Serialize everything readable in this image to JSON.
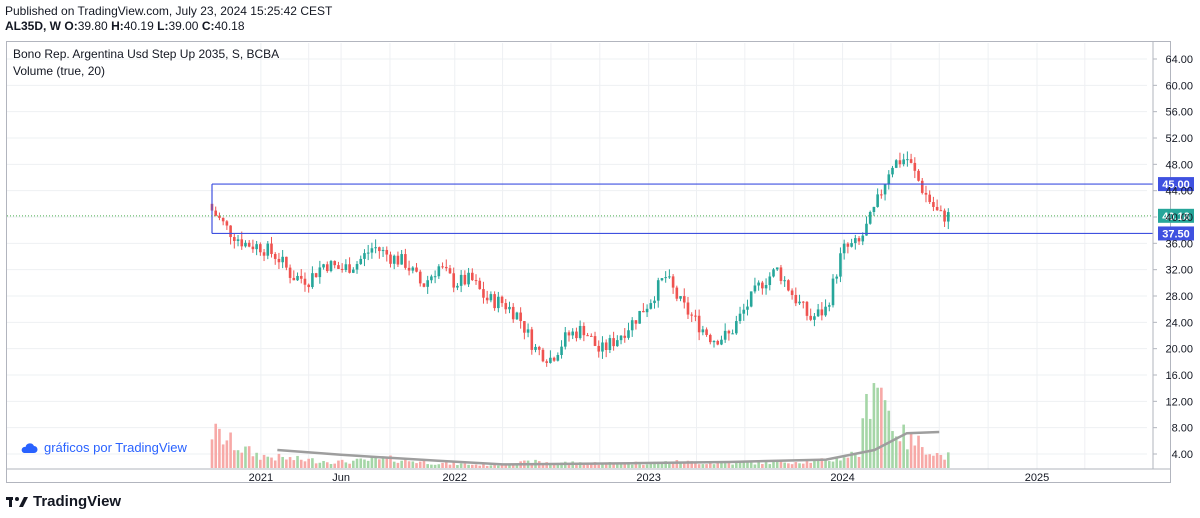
{
  "header": {
    "published": "Published on TradingView.com, July 23, 2024 15:25:42 CEST",
    "symbol": "AL35D, W",
    "o_label": "O:",
    "o_value": "39.80",
    "h_label": "H:",
    "h_value": "40.19",
    "l_label": "L:",
    "l_value": "39.00",
    "c_label": "C:",
    "c_value": "40.18"
  },
  "legend": {
    "instrument": "Bono Rep. Argentina Usd Step Up 2035, S, BCBA",
    "volume_indicator": "Volume (true, 20)"
  },
  "watermark": {
    "text": "gráficos por TradingView",
    "icon": "tradingview-cloud-icon"
  },
  "brand": {
    "text": "TradingView",
    "icon": "tradingview-logo-icon"
  },
  "colors": {
    "up": "#26a69a",
    "down": "#ef5350",
    "vol_up": "#a5d6a7",
    "vol_down": "#f7a9a7",
    "level_line": "#3f51e0",
    "price_line": "#4caf50",
    "vol_ma": "#9e9e9e",
    "grid": "#eef0f3"
  },
  "chart_data": {
    "type": "candlestick",
    "timeframe": "W",
    "y_axis": {
      "ticks": [
        "64.00",
        "60.00",
        "56.00",
        "52.00",
        "48.00",
        "44.00",
        "40.00",
        "36.00",
        "32.00",
        "28.00",
        "24.00",
        "20.00",
        "16.00",
        "12.00",
        "8.00",
        "4.00"
      ],
      "range": [
        0,
        66
      ]
    },
    "x_axis": {
      "ticks": [
        "2021",
        "Jun",
        "2022",
        "2023",
        "2024",
        "2025"
      ]
    },
    "horizontal_levels": [
      {
        "value": 45.0,
        "label": "45.00"
      },
      {
        "value": 37.5,
        "label": "37.50"
      }
    ],
    "last_price": {
      "value": 40.18,
      "label": "40.18"
    },
    "price_series": [
      {
        "date": "2020-10-01",
        "close": 41.0
      },
      {
        "date": "2020-11-01",
        "close": 38.0
      },
      {
        "date": "2020-12-01",
        "close": 36.0
      },
      {
        "date": "2021-01-01",
        "close": 35.5
      },
      {
        "date": "2021-02-01",
        "close": 34.0
      },
      {
        "date": "2021-03-01",
        "close": 31.0
      },
      {
        "date": "2021-04-01",
        "close": 30.5
      },
      {
        "date": "2021-05-01",
        "close": 33.0
      },
      {
        "date": "2021-06-01",
        "close": 32.0
      },
      {
        "date": "2021-07-01",
        "close": 33.0
      },
      {
        "date": "2021-08-01",
        "close": 35.5
      },
      {
        "date": "2021-09-01",
        "close": 34.0
      },
      {
        "date": "2021-10-01",
        "close": 33.0
      },
      {
        "date": "2021-11-01",
        "close": 29.5
      },
      {
        "date": "2021-12-01",
        "close": 32.5
      },
      {
        "date": "2022-01-01",
        "close": 30.0
      },
      {
        "date": "2022-02-01",
        "close": 30.5
      },
      {
        "date": "2022-03-01",
        "close": 27.5
      },
      {
        "date": "2022-04-01",
        "close": 27.0
      },
      {
        "date": "2022-05-01",
        "close": 25.0
      },
      {
        "date": "2022-06-01",
        "close": 20.0
      },
      {
        "date": "2022-07-01",
        "close": 18.5
      },
      {
        "date": "2022-08-01",
        "close": 22.0
      },
      {
        "date": "2022-09-01",
        "close": 23.0
      },
      {
        "date": "2022-10-01",
        "close": 19.5
      },
      {
        "date": "2022-11-01",
        "close": 21.5
      },
      {
        "date": "2022-12-01",
        "close": 24.0
      },
      {
        "date": "2023-01-01",
        "close": 27.0
      },
      {
        "date": "2023-02-01",
        "close": 31.0
      },
      {
        "date": "2023-03-01",
        "close": 27.0
      },
      {
        "date": "2023-04-01",
        "close": 24.0
      },
      {
        "date": "2023-05-01",
        "close": 21.5
      },
      {
        "date": "2023-06-01",
        "close": 22.0
      },
      {
        "date": "2023-07-01",
        "close": 26.0
      },
      {
        "date": "2023-08-01",
        "close": 30.0
      },
      {
        "date": "2023-09-01",
        "close": 32.0
      },
      {
        "date": "2023-10-01",
        "close": 28.0
      },
      {
        "date": "2023-11-01",
        "close": 24.5
      },
      {
        "date": "2023-12-01",
        "close": 26.0
      },
      {
        "date": "2024-01-01",
        "close": 35.0
      },
      {
        "date": "2024-02-01",
        "close": 36.0
      },
      {
        "date": "2024-03-01",
        "close": 41.0
      },
      {
        "date": "2024-04-01",
        "close": 48.0
      },
      {
        "date": "2024-05-01",
        "close": 49.0
      },
      {
        "date": "2024-06-01",
        "close": 44.0
      },
      {
        "date": "2024-07-01",
        "close": 40.18
      }
    ],
    "volume_series": [
      {
        "date": "2020-10-01",
        "volume": 6.0
      },
      {
        "date": "2020-11-01",
        "volume": 4.5
      },
      {
        "date": "2020-12-01",
        "volume": 3.0
      },
      {
        "date": "2021-01-01",
        "volume": 2.0
      },
      {
        "date": "2021-03-01",
        "volume": 1.5
      },
      {
        "date": "2021-06-01",
        "volume": 1.0
      },
      {
        "date": "2021-09-01",
        "volume": 1.5
      },
      {
        "date": "2021-12-01",
        "volume": 0.8
      },
      {
        "date": "2022-03-01",
        "volume": 0.5
      },
      {
        "date": "2022-06-01",
        "volume": 1.0
      },
      {
        "date": "2022-09-01",
        "volume": 0.8
      },
      {
        "date": "2022-12-01",
        "volume": 0.8
      },
      {
        "date": "2023-03-01",
        "volume": 1.0
      },
      {
        "date": "2023-06-01",
        "volume": 0.8
      },
      {
        "date": "2023-09-01",
        "volume": 1.0
      },
      {
        "date": "2023-12-01",
        "volume": 1.2
      },
      {
        "date": "2024-02-01",
        "volume": 2.5
      },
      {
        "date": "2024-03-01",
        "volume": 17.5
      },
      {
        "date": "2024-04-01",
        "volume": 8.0
      },
      {
        "date": "2024-05-01",
        "volume": 4.5
      },
      {
        "date": "2024-06-01",
        "volume": 4.0
      },
      {
        "date": "2024-07-01",
        "volume": 2.0
      }
    ],
    "volume_ma": [
      {
        "date": "2021-02-01",
        "value": 3.0
      },
      {
        "date": "2021-06-01",
        "value": 2.2
      },
      {
        "date": "2021-12-01",
        "value": 1.2
      },
      {
        "date": "2022-04-01",
        "value": 0.6
      },
      {
        "date": "2022-12-01",
        "value": 0.8
      },
      {
        "date": "2023-06-01",
        "value": 1.0
      },
      {
        "date": "2023-12-01",
        "value": 1.4
      },
      {
        "date": "2024-03-01",
        "value": 3.0
      },
      {
        "date": "2024-05-01",
        "value": 5.8
      },
      {
        "date": "2024-07-01",
        "value": 6.0
      }
    ]
  }
}
